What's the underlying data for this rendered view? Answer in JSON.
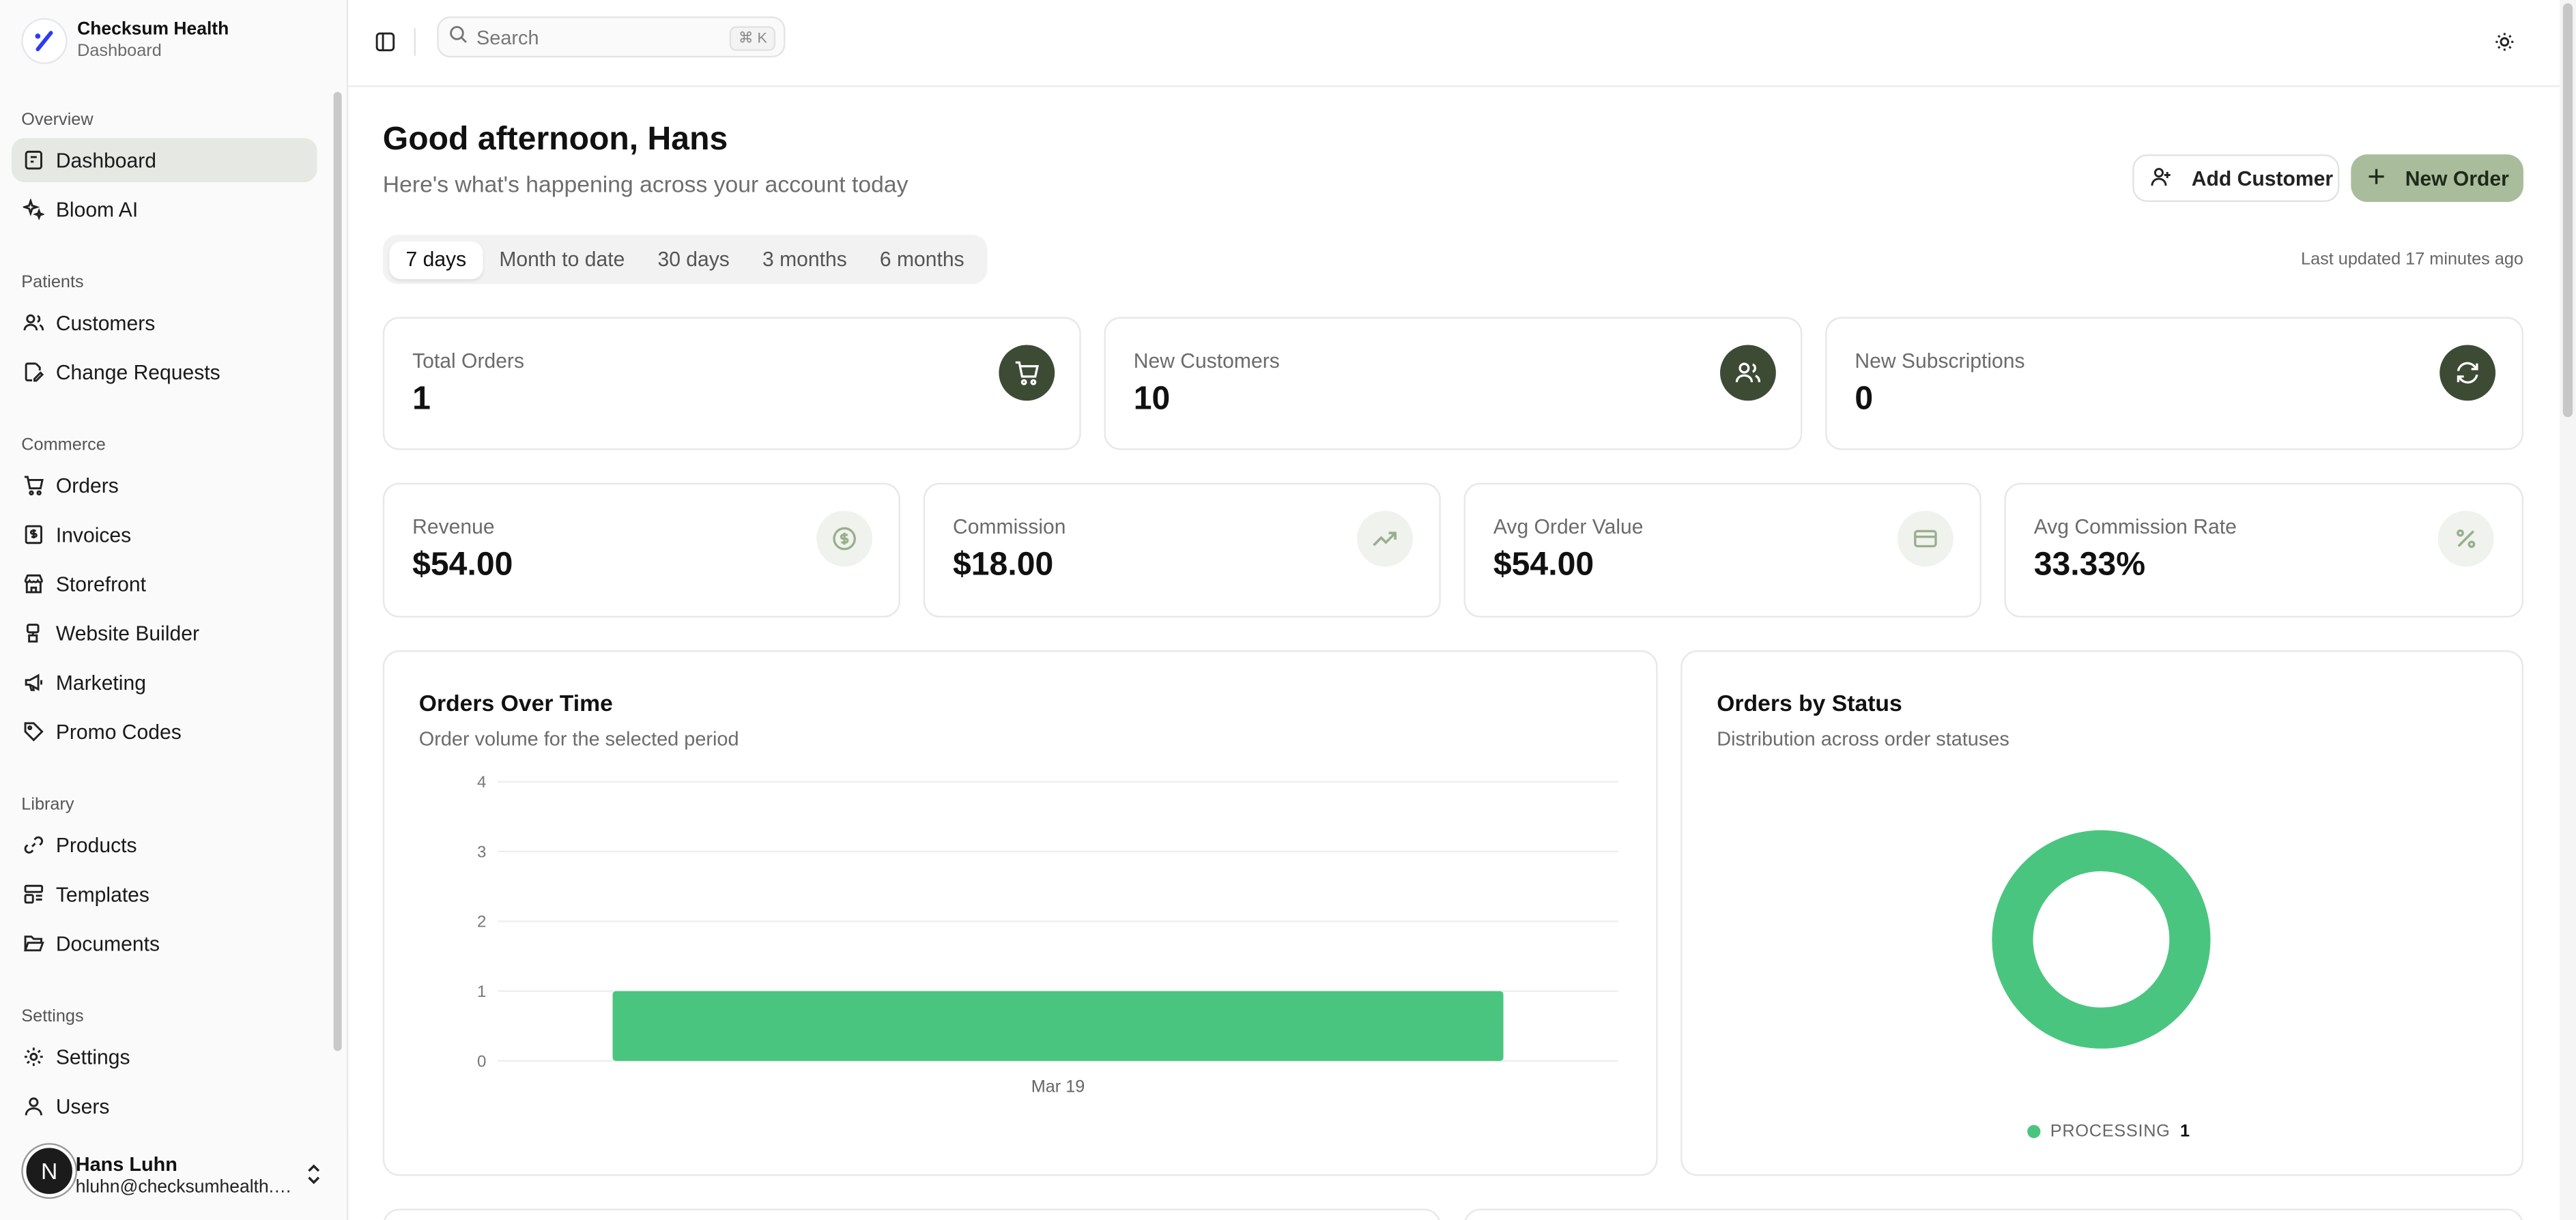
{
  "brand": {
    "name": "Checksum Health",
    "subtitle": "Dashboard"
  },
  "sidebar": {
    "sections": [
      {
        "title": "Overview",
        "items": [
          {
            "label": "Dashboard",
            "icon": "dashboard-icon",
            "active": true
          },
          {
            "label": "Bloom AI",
            "icon": "sparkles-icon"
          }
        ]
      },
      {
        "title": "Patients",
        "items": [
          {
            "label": "Customers",
            "icon": "users-icon"
          },
          {
            "label": "Change Requests",
            "icon": "file-edit-icon"
          }
        ]
      },
      {
        "title": "Commerce",
        "items": [
          {
            "label": "Orders",
            "icon": "cart-icon"
          },
          {
            "label": "Invoices",
            "icon": "receipt-icon"
          },
          {
            "label": "Storefront",
            "icon": "store-icon"
          },
          {
            "label": "Website Builder",
            "icon": "builder-icon"
          },
          {
            "label": "Marketing",
            "icon": "megaphone-icon"
          },
          {
            "label": "Promo Codes",
            "icon": "tag-icon"
          }
        ]
      },
      {
        "title": "Library",
        "items": [
          {
            "label": "Products",
            "icon": "link-icon"
          },
          {
            "label": "Templates",
            "icon": "template-icon"
          },
          {
            "label": "Documents",
            "icon": "folder-icon"
          }
        ]
      },
      {
        "title": "Settings",
        "items": [
          {
            "label": "Settings",
            "icon": "gear-icon"
          },
          {
            "label": "Users",
            "icon": "user-icon"
          }
        ]
      }
    ]
  },
  "user": {
    "initial": "N",
    "name": "Hans Luhn",
    "email": "hluhn@checksumhealth.c..."
  },
  "header": {
    "search_placeholder": "Search",
    "shortcut": "⌘ K"
  },
  "main": {
    "greeting": "Good afternoon, Hans",
    "subtitle": "Here's what's happening across your account today",
    "add_customer": "Add Customer",
    "new_order": "New Order",
    "ranges": [
      "7 days",
      "Month to date",
      "30 days",
      "3 months",
      "6 months"
    ],
    "active_range": "7 days",
    "last_updated": "Last updated 17 minutes ago"
  },
  "stats_top": [
    {
      "label": "Total Orders",
      "value": "1",
      "icon": "cart-icon"
    },
    {
      "label": "New Customers",
      "value": "10",
      "icon": "users-icon"
    },
    {
      "label": "New Subscriptions",
      "value": "0",
      "icon": "refresh-icon"
    }
  ],
  "stats_bottom": [
    {
      "label": "Revenue",
      "value": "$54.00",
      "icon": "dollar-icon"
    },
    {
      "label": "Commission",
      "value": "$18.00",
      "icon": "trending-up-icon"
    },
    {
      "label": "Avg Order Value",
      "value": "$54.00",
      "icon": "credit-card-icon"
    },
    {
      "label": "Avg Commission Rate",
      "value": "33.33%",
      "icon": "percent-icon"
    }
  ],
  "orders_chart": {
    "title": "Orders Over Time",
    "subtitle": "Order volume for the selected period"
  },
  "status_chart": {
    "title": "Orders by Status",
    "subtitle": "Distribution across order statuses"
  },
  "colors": {
    "accent": "#3d4b35",
    "accent_light": "#a9bd9d",
    "chart_green": "#4ac57f",
    "active_nav": "#e6e9e3"
  },
  "chart_data": [
    {
      "type": "bar",
      "title": "Orders Over Time",
      "categories": [
        "Mar 19"
      ],
      "values": [
        1
      ],
      "ylim": [
        0,
        4
      ],
      "yticks": [
        0,
        1,
        2,
        3,
        4
      ],
      "xlabel": "",
      "ylabel": "",
      "grid": true
    },
    {
      "type": "pie",
      "title": "Orders by Status",
      "donut": true,
      "labels": [
        "PROCESSING"
      ],
      "values": [
        1
      ],
      "legend": "bottom"
    }
  ]
}
